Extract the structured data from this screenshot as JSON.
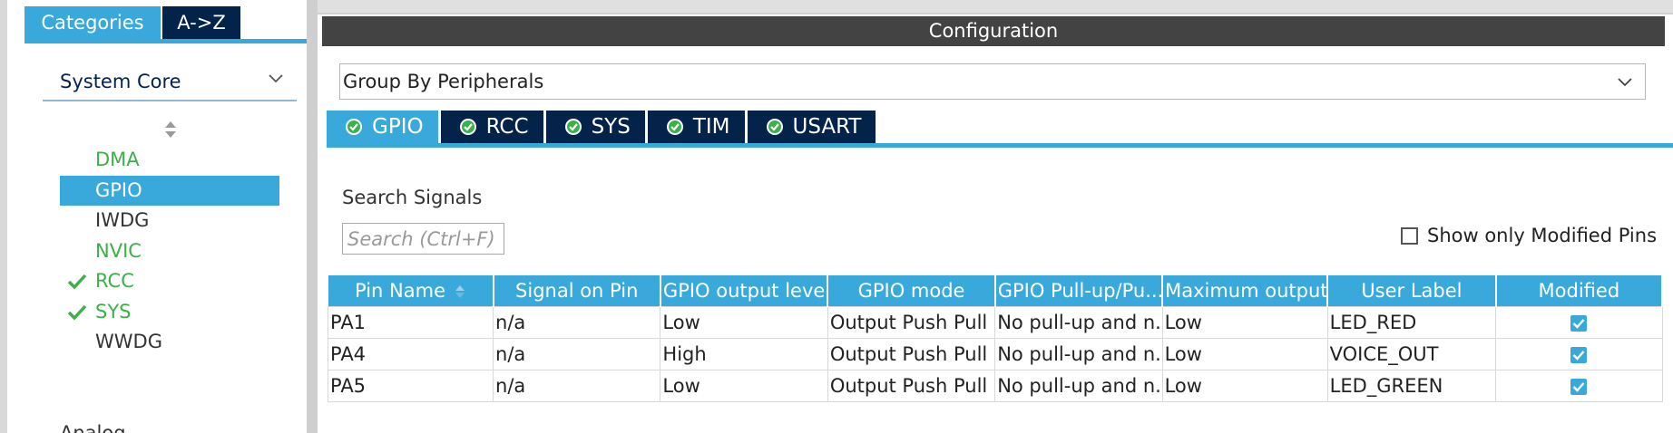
{
  "categories_panel": {
    "tabs": [
      {
        "label": "Categories",
        "active": true
      },
      {
        "label": "A->Z",
        "active": false
      }
    ],
    "group": {
      "label": "System Core"
    },
    "items": [
      {
        "label": "DMA",
        "state": "configured",
        "checked": false
      },
      {
        "label": "GPIO",
        "state": "selected",
        "checked": false
      },
      {
        "label": "IWDG",
        "state": "default",
        "checked": false
      },
      {
        "label": "NVIC",
        "state": "configured",
        "checked": false
      },
      {
        "label": "RCC",
        "state": "configured",
        "checked": true
      },
      {
        "label": "SYS",
        "state": "configured",
        "checked": true
      },
      {
        "label": "WWDG",
        "state": "default",
        "checked": false
      }
    ],
    "next_group_label": "Analog"
  },
  "config": {
    "title": "Configuration",
    "group_by": "Group By Peripherals",
    "peripheral_tabs": [
      {
        "label": "GPIO",
        "active": true
      },
      {
        "label": "RCC",
        "active": false
      },
      {
        "label": "SYS",
        "active": false
      },
      {
        "label": "TIM",
        "active": false
      },
      {
        "label": "USART",
        "active": false
      }
    ],
    "search_label": "Search Signals",
    "search_placeholder": "Search (Ctrl+F)",
    "show_modified_label": "Show only Modified Pins",
    "show_modified_checked": false
  },
  "table": {
    "columns": [
      "Pin Name",
      "Signal on Pin",
      "GPIO output level",
      "GPIO mode",
      "GPIO Pull-up/Pu...",
      "Maximum output...",
      "User Label",
      "Modified"
    ],
    "rows": [
      {
        "pin": "PA1",
        "signal": "n/a",
        "level": "Low",
        "mode": "Output Push Pull",
        "pull": "No pull-up and n...",
        "speed": "Low",
        "label": "LED_RED",
        "modified": true
      },
      {
        "pin": "PA4",
        "signal": "n/a",
        "level": "High",
        "mode": "Output Push Pull",
        "pull": "No pull-up and n...",
        "speed": "Low",
        "label": "VOICE_OUT",
        "modified": true
      },
      {
        "pin": "PA5",
        "signal": "n/a",
        "level": "Low",
        "mode": "Output Push Pull",
        "pull": "No pull-up and n...",
        "speed": "Low",
        "label": "LED_GREEN",
        "modified": true
      }
    ]
  },
  "colors": {
    "accent": "#39a9dc",
    "navy": "#03234b",
    "configured": "#3cb04a",
    "header_bar": "#434343"
  },
  "icons": {
    "ok": "check-circle-icon",
    "check": "checkmark-icon",
    "chevron": "chevron-down-icon",
    "sort": "sort-icon"
  }
}
